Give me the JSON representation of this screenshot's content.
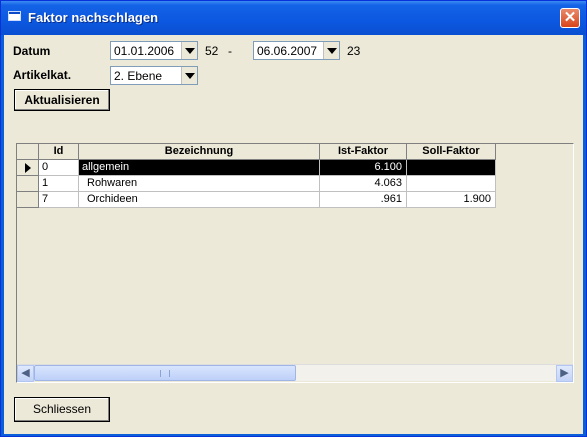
{
  "window": {
    "title": "Faktor nachschlagen"
  },
  "filters": {
    "datum_label": "Datum",
    "date_from": "01.01.2006",
    "week_from": "52",
    "separator": "-",
    "date_to": "06.06.2007",
    "week_to": "23",
    "artikelkat_label": "Artikelkat.",
    "artikelkat_value": "2. Ebene"
  },
  "buttons": {
    "refresh": "Aktualisieren",
    "close": "Schliessen"
  },
  "table": {
    "columns": [
      "Id",
      "Bezeichnung",
      "Ist-Faktor",
      "Soll-Faktor"
    ],
    "rows": [
      {
        "id": "0",
        "name": "allgemein",
        "ist": "6.100",
        "soll": "",
        "selected": true
      },
      {
        "id": "1",
        "name": " Rohwaren",
        "ist": "4.063",
        "soll": "",
        "selected": false
      },
      {
        "id": "7",
        "name": " Orchideen",
        "ist": ".961",
        "soll": "1.900",
        "selected": false
      }
    ]
  },
  "icons": [
    "window-icon",
    "close-icon",
    "dropdown-arrow-icon",
    "row-pointer-icon",
    "scroll-left-icon",
    "scroll-right-icon"
  ]
}
